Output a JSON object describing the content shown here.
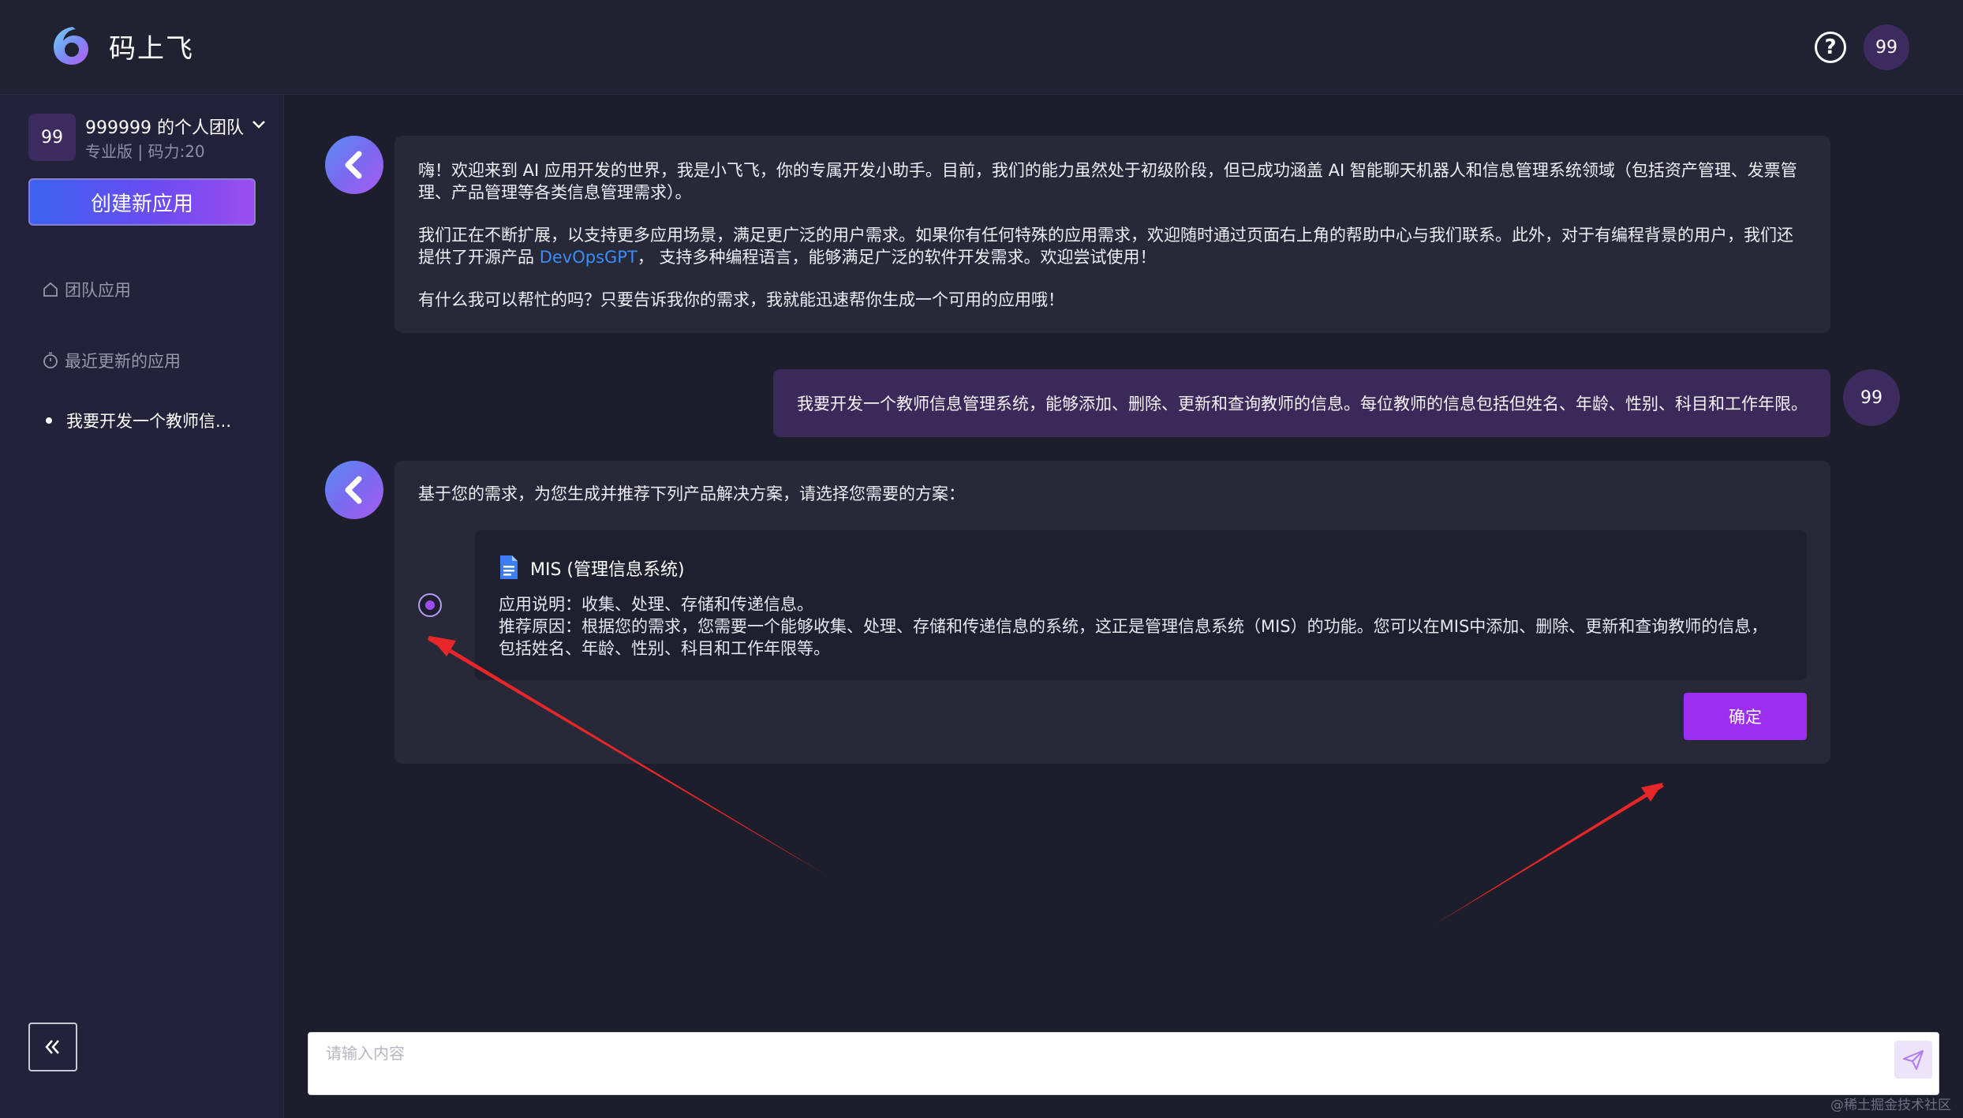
{
  "header": {
    "app_name": "码上飞",
    "help_glyph": "?",
    "user_avatar_text": "99"
  },
  "sidebar": {
    "team_avatar_text": "99",
    "team_name": "999999 的个人团队",
    "team_meta": "专业版 | 码力:20",
    "create_app_label": "创建新应用",
    "nav_team_apps": "团队应用",
    "nav_recent_apps": "最近更新的应用",
    "recent_items": [
      "我要开发一个教师信..."
    ]
  },
  "chat": {
    "welcome_para1": "嗨！欢迎来到 AI 应用开发的世界，我是小飞飞，你的专属开发小助手。目前，我们的能力虽然处于初级阶段，但已成功涵盖 AI 智能聊天机器人和信息管理系统领域（包括资产管理、发票管理、产品管理等各类信息管理需求）。",
    "welcome_para2_a": "我们正在不断扩展，以支持更多应用场景，满足更广泛的用户需求。如果你有任何特殊的应用需求，欢迎随时通过页面右上角的帮助中心与我们联系。此外，对于有编程背景的用户，我们还提供了开源产品",
    "welcome_link": "DevOpsGPT",
    "welcome_para2_b": "， 支持多种编程语言，能够满足广泛的软件开发需求。欢迎尝试使用！",
    "welcome_para3": "有什么我可以帮忙的吗？只要告诉我你的需求，我就能迅速帮你生成一个可用的应用哦！",
    "user_message": "我要开发一个教师信息管理系统，能够添加、删除、更新和查询教师的信息。每位教师的信息包括但姓名、年龄、性别、科目和工作年限。",
    "user_avatar_text": "99",
    "solution_intro": "基于您的需求，为您生成并推荐下列产品解决方案，请选择您需要的方案：",
    "option": {
      "title": "MIS (管理信息系统)",
      "desc_line1": "应用说明：收集、处理、存储和传递信息。",
      "desc_line2": "推荐原因：根据您的需求，您需要一个能够收集、处理、存储和传递信息的系统，这正是管理信息系统（MIS）的功能。您可以在MIS中添加、删除、更新和查询教师的信息，包括姓名、年龄、性别、科目和工作年限等。",
      "selected": true
    },
    "confirm_label": "确定"
  },
  "input": {
    "placeholder": "请输入内容"
  },
  "watermark": "@稀土掘金技术社区",
  "colors": {
    "accent": "#9b2ef0",
    "user_bubble": "#3b2959",
    "link": "#3b8cf5",
    "arrow": "#e8262a"
  }
}
